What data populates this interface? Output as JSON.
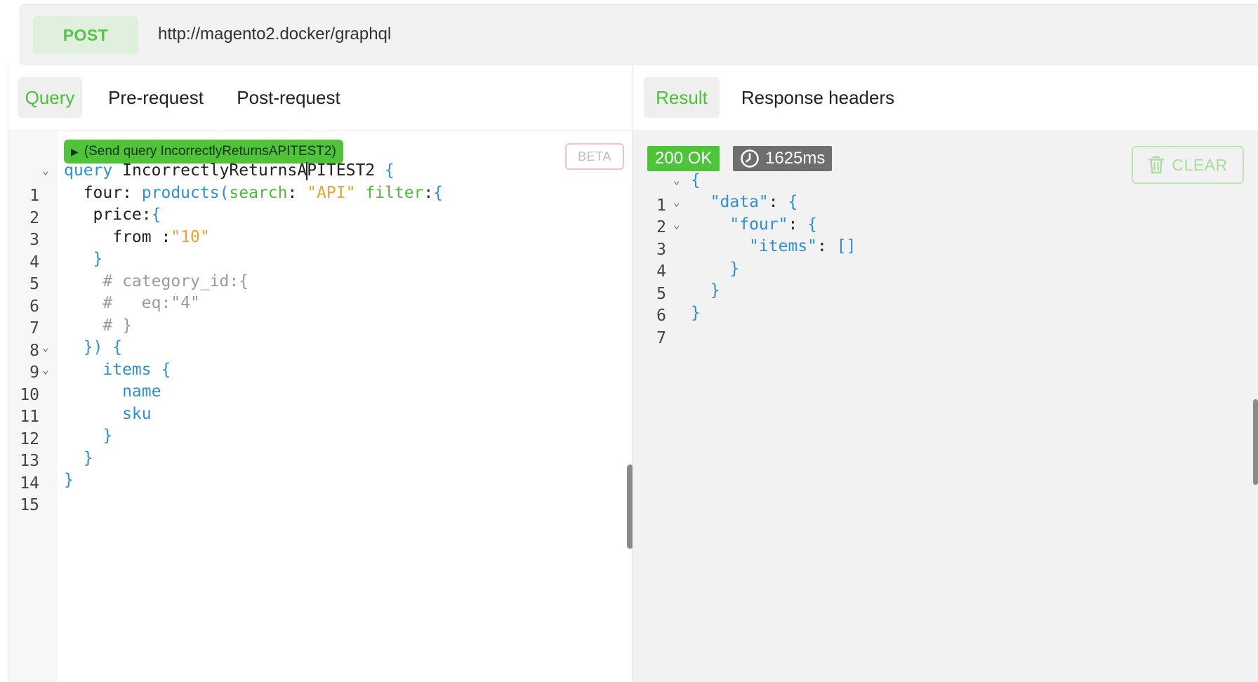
{
  "request": {
    "method": "POST",
    "url": "http://magento2.docker/graphql"
  },
  "left_tabs": [
    {
      "label": "Query",
      "active": true
    },
    {
      "label": "Pre-request",
      "active": false
    },
    {
      "label": "Post-request",
      "active": false
    }
  ],
  "right_tabs": [
    {
      "label": "Result",
      "active": true
    },
    {
      "label": "Response headers",
      "active": false
    }
  ],
  "editor": {
    "send_button": "(Send query IncorrectlyReturnsAPITEST2)",
    "beta_label": "BETA",
    "line_numbers": [
      "1",
      "2",
      "3",
      "4",
      "5",
      "6",
      "7",
      "8",
      "9",
      "10",
      "11",
      "12",
      "13",
      "14",
      "15"
    ],
    "lines": [
      {
        "a": "query",
        "b": " IncorrectlyReturnsA",
        "c": "PITEST2",
        "d": " {"
      },
      {
        "a": "  four",
        "b": ": ",
        "c": "products(",
        "d": "search",
        "e": ": ",
        "f": "\"API\"",
        "g": " filter",
        "h": ":",
        "i": "{"
      },
      {
        "a": "   price",
        "b": ":",
        "c": "{"
      },
      {
        "a": "     from ",
        "b": ":",
        "c": "\"10\""
      },
      {
        "a": "   }"
      },
      {
        "a": "    # category_id:{"
      },
      {
        "a": "    #   eq:\"4\""
      },
      {
        "a": "    # }"
      },
      {
        "a": "  }) {"
      },
      {
        "a": "    items {"
      },
      {
        "a": "      name"
      },
      {
        "a": "      sku"
      },
      {
        "a": "    }"
      },
      {
        "a": "  }"
      },
      {
        "a": "}"
      }
    ]
  },
  "result": {
    "status": "200 OK",
    "time": "1625ms",
    "clear_label": "CLEAR",
    "line_numbers": [
      "1",
      "2",
      "3",
      "4",
      "5",
      "6",
      "7"
    ],
    "lines": [
      {
        "a": "{"
      },
      {
        "a": "  \"data\"",
        "b": ": ",
        "c": "{"
      },
      {
        "a": "    \"four\"",
        "b": ": ",
        "c": "{"
      },
      {
        "a": "      \"items\"",
        "b": ": ",
        "c": "[]"
      },
      {
        "a": "    }"
      },
      {
        "a": "  }"
      },
      {
        "a": "}"
      }
    ]
  },
  "icons": {
    "play": "play-icon",
    "clock": "clock-icon",
    "trash": "trash-icon",
    "fold": "chevron-down-icon"
  },
  "colors": {
    "accent_green": "#4fc43a",
    "keyword_blue": "#2f8fd1",
    "string_orange": "#e8a235",
    "comment_gray": "#9a9a9a"
  }
}
